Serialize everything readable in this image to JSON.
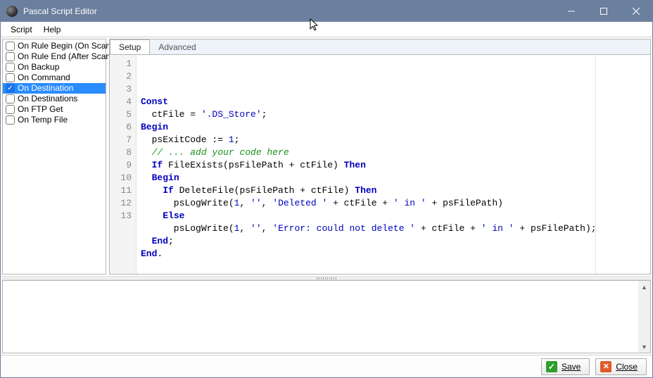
{
  "window": {
    "title": "Pascal Script Editor"
  },
  "menubar": {
    "script": "Script",
    "help": "Help"
  },
  "sidebar": {
    "items": [
      {
        "label": "On Rule Begin (On Scan)",
        "checked": false,
        "selected": false
      },
      {
        "label": "On Rule End (After Scan)",
        "checked": false,
        "selected": false
      },
      {
        "label": "On Backup",
        "checked": false,
        "selected": false
      },
      {
        "label": "On Command",
        "checked": false,
        "selected": false
      },
      {
        "label": "On Destination",
        "checked": true,
        "selected": true
      },
      {
        "label": "On Destinations",
        "checked": false,
        "selected": false
      },
      {
        "label": "On FTP Get",
        "checked": false,
        "selected": false
      },
      {
        "label": "On Temp File",
        "checked": false,
        "selected": false
      }
    ]
  },
  "tabs": {
    "setup": "Setup",
    "advanced": "Advanced"
  },
  "code": {
    "lines": [
      {
        "n": 1,
        "tokens": [
          {
            "t": "Const",
            "c": "kw"
          }
        ]
      },
      {
        "n": 2,
        "tokens": [
          {
            "t": "  ctFile = ",
            "c": "id"
          },
          {
            "t": "'.DS_Store'",
            "c": "str"
          },
          {
            "t": ";",
            "c": "id"
          }
        ]
      },
      {
        "n": 3,
        "tokens": [
          {
            "t": "Begin",
            "c": "kw"
          }
        ]
      },
      {
        "n": 4,
        "tokens": [
          {
            "t": "  psExitCode := ",
            "c": "id"
          },
          {
            "t": "1",
            "c": "num"
          },
          {
            "t": ";",
            "c": "id"
          }
        ]
      },
      {
        "n": 5,
        "tokens": [
          {
            "t": "  // ... add your code here",
            "c": "cmt"
          }
        ]
      },
      {
        "n": 6,
        "tokens": [
          {
            "t": "  ",
            "c": "id"
          },
          {
            "t": "If",
            "c": "kw"
          },
          {
            "t": " FileExists(psFilePath + ctFile) ",
            "c": "id"
          },
          {
            "t": "Then",
            "c": "kw"
          }
        ]
      },
      {
        "n": 7,
        "tokens": [
          {
            "t": "  ",
            "c": "id"
          },
          {
            "t": "Begin",
            "c": "kw"
          }
        ]
      },
      {
        "n": 8,
        "tokens": [
          {
            "t": "    ",
            "c": "id"
          },
          {
            "t": "If",
            "c": "kw"
          },
          {
            "t": " DeleteFile(psFilePath + ctFile) ",
            "c": "id"
          },
          {
            "t": "Then",
            "c": "kw"
          }
        ]
      },
      {
        "n": 9,
        "tokens": [
          {
            "t": "      psLogWrite(",
            "c": "id"
          },
          {
            "t": "1",
            "c": "num"
          },
          {
            "t": ", ",
            "c": "id"
          },
          {
            "t": "''",
            "c": "str"
          },
          {
            "t": ", ",
            "c": "id"
          },
          {
            "t": "'Deleted '",
            "c": "str"
          },
          {
            "t": " + ctFile + ",
            "c": "id"
          },
          {
            "t": "' in '",
            "c": "str"
          },
          {
            "t": " + psFilePath)",
            "c": "id"
          }
        ]
      },
      {
        "n": 10,
        "tokens": [
          {
            "t": "    ",
            "c": "id"
          },
          {
            "t": "Else",
            "c": "kw"
          }
        ]
      },
      {
        "n": 11,
        "tokens": [
          {
            "t": "      psLogWrite(",
            "c": "id"
          },
          {
            "t": "1",
            "c": "num"
          },
          {
            "t": ", ",
            "c": "id"
          },
          {
            "t": "''",
            "c": "str"
          },
          {
            "t": ", ",
            "c": "id"
          },
          {
            "t": "'Error: could not delete '",
            "c": "str"
          },
          {
            "t": " + ctFile + ",
            "c": "id"
          },
          {
            "t": "' in '",
            "c": "str"
          },
          {
            "t": " + psFilePath);",
            "c": "id"
          }
        ]
      },
      {
        "n": 12,
        "tokens": [
          {
            "t": "  ",
            "c": "id"
          },
          {
            "t": "End",
            "c": "kw"
          },
          {
            "t": ";",
            "c": "id"
          }
        ]
      },
      {
        "n": 13,
        "tokens": [
          {
            "t": "End",
            "c": "kw"
          },
          {
            "t": ".",
            "c": "id"
          }
        ]
      }
    ]
  },
  "footer": {
    "save": "Save",
    "close": "Close"
  }
}
